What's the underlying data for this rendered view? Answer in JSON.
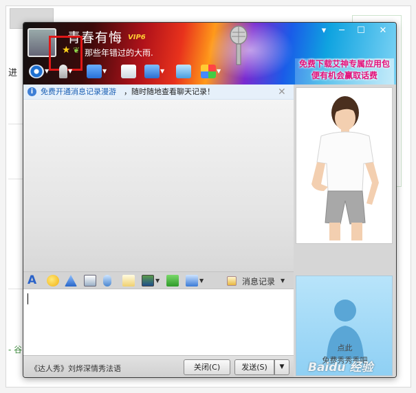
{
  "window": {
    "name": "青春有悔",
    "vip_badge": "VIP6",
    "signature": "那些年错过的大雨.",
    "controls": {
      "minimize": "─",
      "maximize": "☐",
      "close": "✕",
      "menu": "▾"
    }
  },
  "ad_banner": {
    "line1": "免费下载艾神专属应用包",
    "line2": "便有机会赢取话费"
  },
  "notice": {
    "link": "免费开通消息记录漫游",
    "text": "，随时随地查看聊天记录！",
    "close": "✕"
  },
  "show_panel": {
    "line1": "点此",
    "line2": "免费秀秀秀吧"
  },
  "format_bar": {
    "history_label": "消息记录",
    "font_glyph": "A"
  },
  "bottom_bar": {
    "music_text": "《达人秀》刘烨深情秀法语",
    "close_button": "关闭(C)",
    "send_button": "发送(S)",
    "send_menu": "▼"
  },
  "background_page": {
    "left_fragment": "进",
    "green_fragment": "- 谷"
  },
  "watermark": "Baidu 经验",
  "colors": {
    "notice_link": "#1a5fb4",
    "ad_text": "#e0107a",
    "highlight_box": "#e01818"
  }
}
